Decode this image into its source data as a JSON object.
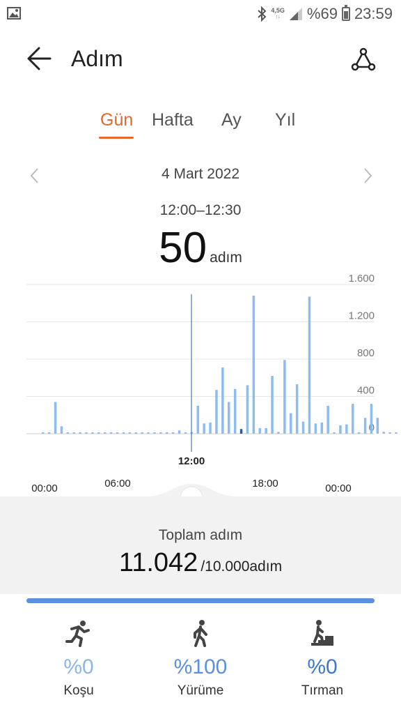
{
  "status_bar": {
    "network": "4,5G",
    "battery_text": "%69",
    "battery_level": 0.69,
    "time": "23:59",
    "icons": [
      "gallery-icon",
      "bluetooth-icon",
      "signal-icon",
      "battery-icon"
    ]
  },
  "header": {
    "title": "Adım",
    "icons": [
      "back-arrow-icon",
      "share-icon"
    ]
  },
  "tabs": [
    {
      "label": "Gün",
      "active": true
    },
    {
      "label": "Hafta",
      "active": false
    },
    {
      "label": "Ay",
      "active": false
    },
    {
      "label": "Yıl",
      "active": false
    }
  ],
  "date": {
    "label": "4 Mart 2022",
    "icons": [
      "chevron-left-icon",
      "chevron-right-icon"
    ]
  },
  "selection": {
    "time_range": "12:00–12:30",
    "value": "50",
    "unit": "adım"
  },
  "chart_data": {
    "type": "bar",
    "y_ticks": [
      "1.600",
      "1.200",
      "800",
      "400",
      "0"
    ],
    "ylim": [
      0,
      1600
    ],
    "x_ticks": [
      "00:00",
      "06:00",
      "12:00",
      "18:00",
      "00:00"
    ],
    "selected_label": "12:00",
    "grid": true,
    "bar_color": "#8dbdf0",
    "selected_color": "#1f5fb0",
    "half_hour_values": [
      0,
      0,
      340,
      80,
      15,
      0,
      10,
      0,
      0,
      0,
      0,
      0,
      0,
      0,
      0,
      0,
      0,
      0,
      0,
      0,
      0,
      0,
      35,
      0,
      10,
      300,
      110,
      120,
      470,
      710,
      340,
      480,
      50,
      520,
      1480,
      60,
      60,
      620,
      20,
      790,
      220,
      530,
      130,
      1470,
      110,
      120,
      300,
      0,
      90,
      100,
      320,
      0,
      170,
      320,
      170,
      20,
      0,
      0
    ]
  },
  "summary": {
    "label": "Toplam adım",
    "total": "11.042",
    "goal": "/10.000adım",
    "progress": 1.0
  },
  "activities": [
    {
      "label": "Koşu",
      "percent": "%0",
      "icon": "running-icon",
      "color": "#8ab6ea"
    },
    {
      "label": "Yürüme",
      "percent": "%100",
      "icon": "walking-icon",
      "color": "#5b8fe0"
    },
    {
      "label": "Tırman",
      "percent": "%0",
      "icon": "climbing-stairs-icon",
      "color": "#3a78cc"
    }
  ],
  "colors": {
    "accent": "#e8662c",
    "progress": "#5b8fe0",
    "panel": "#f2f2f2"
  }
}
